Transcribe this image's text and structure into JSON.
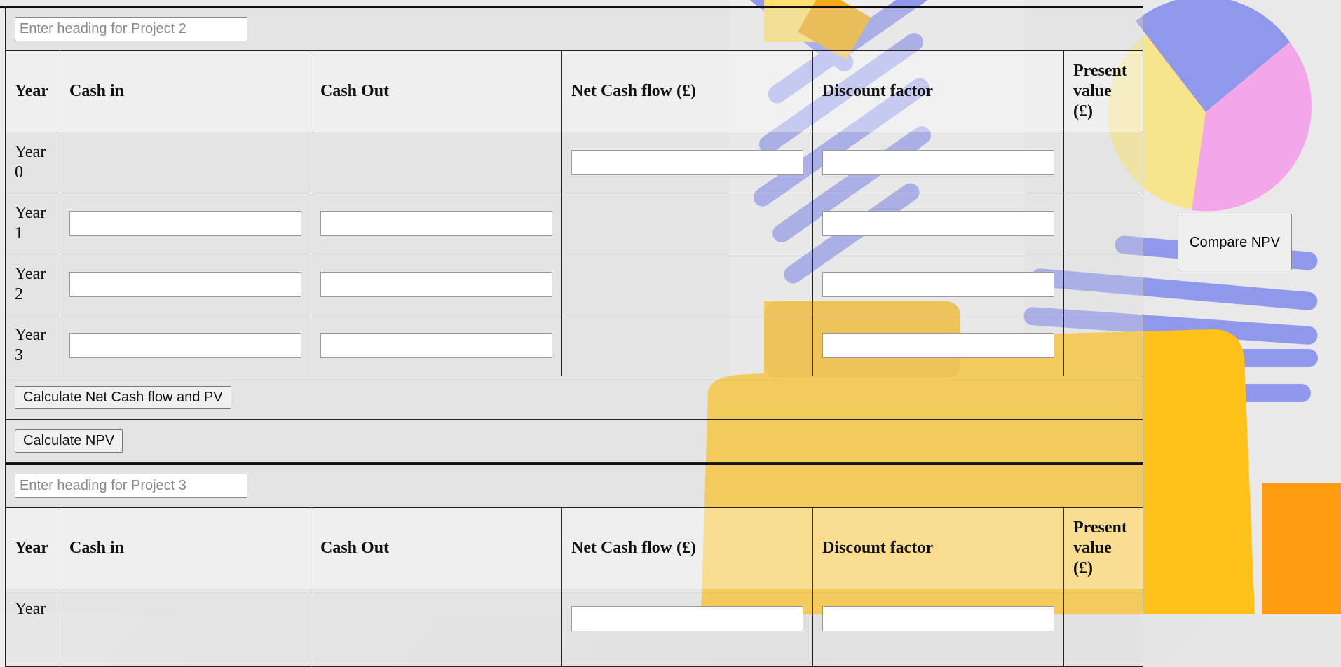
{
  "project2": {
    "heading_placeholder": "Enter heading for Project 2",
    "columns": [
      "Year",
      "Cash in",
      "Cash Out",
      "Net Cash flow (£)",
      "Discount factor",
      "Present value (£)"
    ],
    "rows": [
      {
        "year": "Year 0"
      },
      {
        "year": "Year 1"
      },
      {
        "year": "Year 2"
      },
      {
        "year": "Year 3"
      }
    ],
    "calc_cashflow_label": "Calculate Net Cash flow and PV",
    "calc_npv_label": "Calculate NPV"
  },
  "project3": {
    "heading_placeholder": "Enter heading for Project 3",
    "columns": [
      "Year",
      "Cash in",
      "Cash Out",
      "Net Cash flow (£)",
      "Discount factor",
      "Present value (£)"
    ],
    "rows": [
      {
        "year": "Year"
      }
    ]
  },
  "compare_label": "Compare NPV",
  "colors": {
    "accent_yellow": "#ffc21a",
    "accent_blue": "#8f98ea",
    "accent_pink": "#f3a6ea"
  }
}
